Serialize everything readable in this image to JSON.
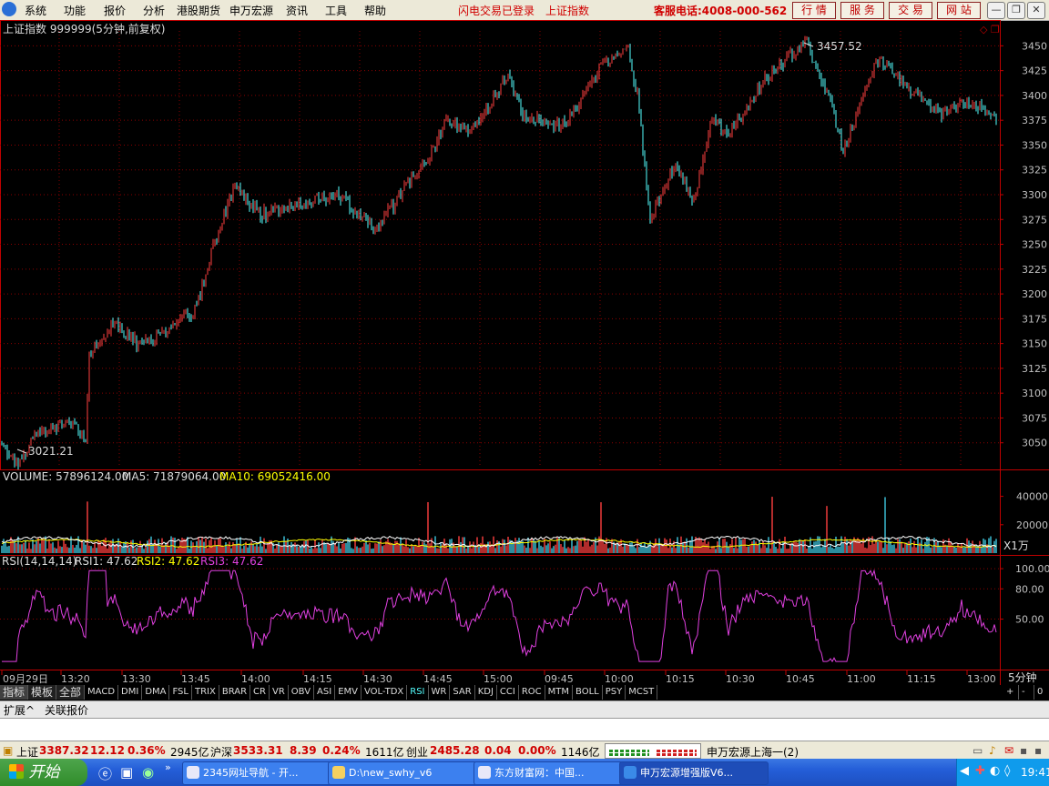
{
  "menubar": {
    "items": [
      "系统",
      "功能",
      "报价",
      "分析",
      "港股期货",
      "申万宏源",
      "资讯",
      "工具",
      "帮助"
    ],
    "notice1": "闪电交易已登录",
    "notice2": "上证指数",
    "service": "客服电话:4008-000-562",
    "tabs": [
      "行 情",
      "服 务",
      "交 易",
      "网 站"
    ]
  },
  "chart": {
    "title": "上证指数 999999(5分钟,前复权)",
    "high_label": "3457.52",
    "low_label": "3021.21",
    "price_ticks": [
      "3450",
      "3425",
      "3400",
      "3375",
      "3350",
      "3325",
      "3300",
      "3275",
      "3250",
      "3225",
      "3200",
      "3175",
      "3150",
      "3125",
      "3100",
      "3075",
      "3050"
    ],
    "price_min": 3025,
    "price_max": 3465,
    "colors": {
      "up": "#ff4040",
      "down": "#54ffff",
      "grid": "#8a0000",
      "axis": "#c00000",
      "ma5": "#ffffff",
      "ma10": "#ffff00",
      "rsi": "#e040e0"
    }
  },
  "volume": {
    "label": "VOLUME: 57896124.00",
    "ma5": "MA5: 71879064.00",
    "ma10": "MA10: 69052416.00",
    "ticks": [
      "40000",
      "20000"
    ],
    "unit": "X1万"
  },
  "rsi": {
    "label": "RSI(14,14,14)",
    "rsi1": "RSI1: 47.62",
    "rsi2": "RSI2: 47.62",
    "rsi3": "RSI3: 47.62",
    "ticks": [
      "100.00",
      "80.00",
      "50.00"
    ]
  },
  "time_axis": {
    "labels": [
      "09月29日",
      "13:20",
      "13:30",
      "13:45",
      "14:00",
      "14:15",
      "14:30",
      "14:45",
      "15:00",
      "09:45",
      "10:00",
      "10:15",
      "10:30",
      "10:45",
      "11:00",
      "11:15",
      "13:00"
    ],
    "period": "5分钟"
  },
  "indicators": [
    "指标",
    "模板",
    "全部",
    "MACD",
    "DMI",
    "DMA",
    "FSL",
    "TRIX",
    "BRAR",
    "CR",
    "VR",
    "OBV",
    "ASI",
    "EMV",
    "VOL-TDX",
    "RSI",
    "WR",
    "SAR",
    "KDJ",
    "CCI",
    "ROC",
    "MTM",
    "BOLL",
    "PSY",
    "MCST"
  ],
  "active_indicator": "RSI",
  "ind_controls": [
    "+",
    "-",
    "0"
  ],
  "ext_bar": [
    "扩展^",
    "关联报价"
  ],
  "status": {
    "sh_name": "上证",
    "sh_value": "3387.32",
    "sh_change": "12.12",
    "sh_pct": "0.36%",
    "sh_amount": "2945亿",
    "hs_name": "沪深",
    "hs_value": "3533.31",
    "hs_change": "8.39",
    "hs_pct": "0.24%",
    "hs_amount": "1611亿",
    "cy_name": "创业",
    "cy_value": "2485.28",
    "cy_change": "0.04",
    "cy_pct": "0.00%",
    "cy_amount": "1146亿",
    "broker": "申万宏源上海一(2)"
  },
  "taskbar": {
    "start": "开始",
    "tasks": [
      "2345网址导航 - 开...",
      "D:\\new_swhy_v6",
      "东方财富网：中国...",
      "申万宏源增强版V6..."
    ],
    "clock": "19:41"
  }
}
